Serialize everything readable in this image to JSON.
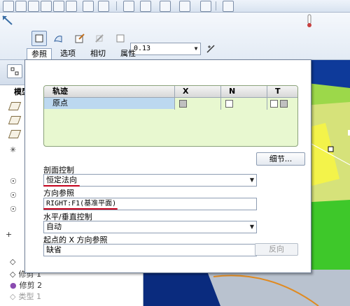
{
  "ribbon": {
    "thickness_value": "0.13",
    "tabs": [
      "参照",
      "选项",
      "相切",
      "属性"
    ]
  },
  "model_tree": {
    "label": "模型",
    "items": [
      "修剪 1",
      "修剪 2",
      "类型 1"
    ]
  },
  "panel": {
    "trajectory": {
      "columns": [
        "轨迹",
        "X",
        "N",
        "T"
      ],
      "rows": [
        {
          "name": "原点"
        }
      ]
    },
    "detail_button": "细节...",
    "section_control": {
      "label": "剖面控制",
      "value": "恒定法向"
    },
    "direction_ref": {
      "label": "方向参照",
      "value": "RIGHT:F1(基准平面)"
    },
    "hv_control": {
      "label": "水平/垂直控制",
      "value": "自动"
    },
    "start_x_dir": {
      "label": "起点的 X 方向参照",
      "value": "缺省"
    },
    "flip_button": "反向"
  },
  "colors": {
    "highlight": "#c4001a",
    "selection": "#bcd8f0",
    "trajectory_bg": "#e8f8d0"
  }
}
